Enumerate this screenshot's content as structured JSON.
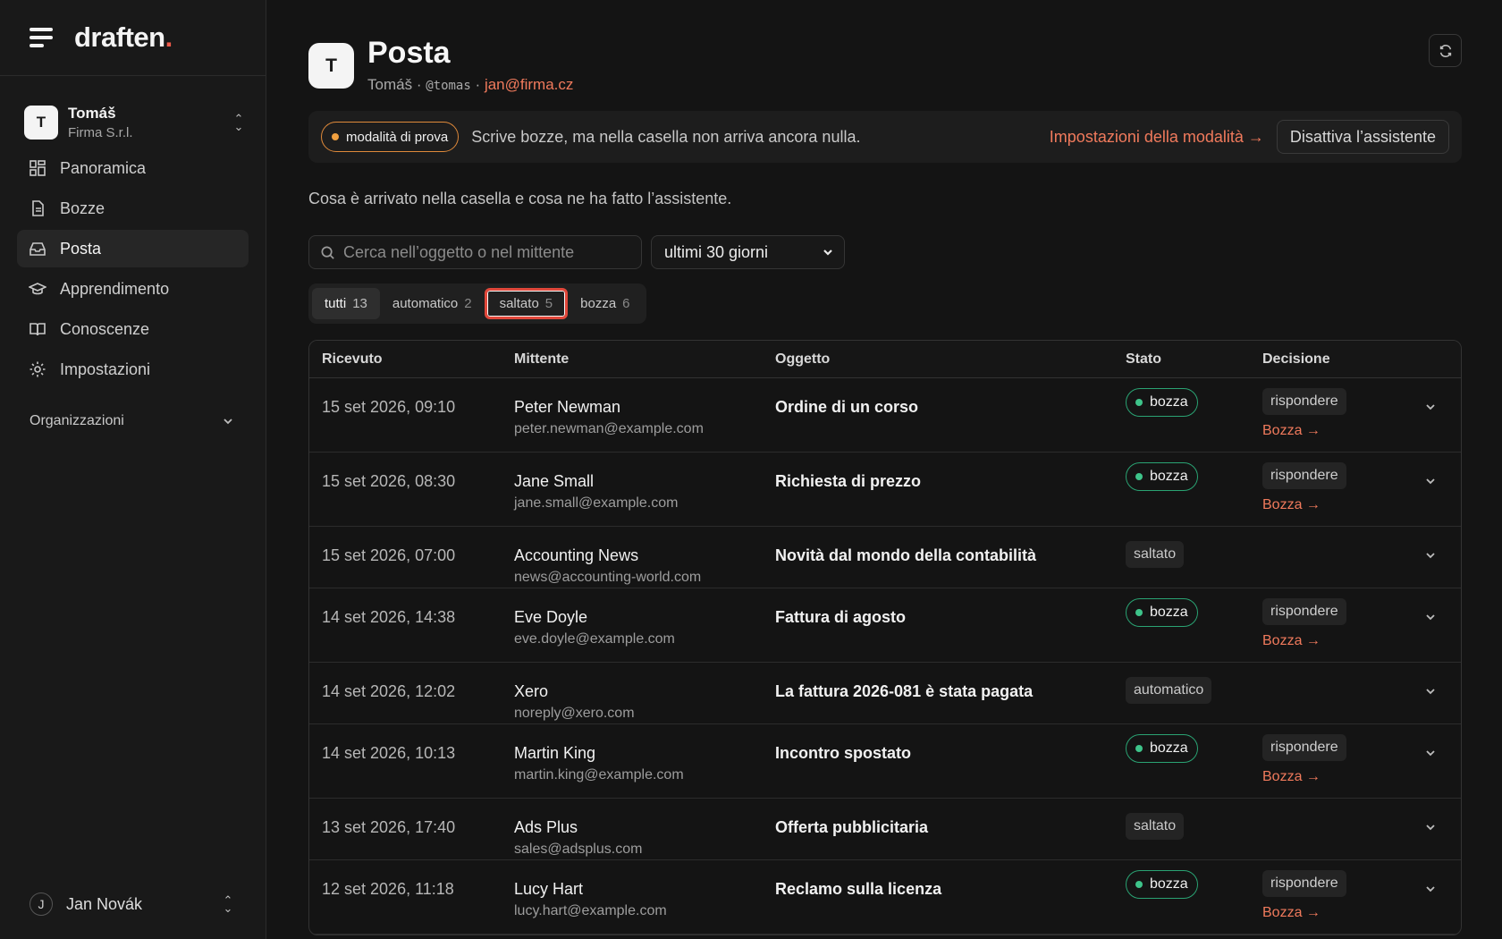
{
  "brand": {
    "name": "draften",
    "dot": "."
  },
  "account": {
    "initial": "T",
    "name": "Tomáš",
    "org": "Firma S.r.l."
  },
  "nav": [
    {
      "label": "Panoramica",
      "icon": "dashboard-icon"
    },
    {
      "label": "Bozze",
      "icon": "document-icon"
    },
    {
      "label": "Posta",
      "icon": "inbox-icon",
      "active": true
    },
    {
      "label": "Apprendimento",
      "icon": "graduation-cap-icon"
    },
    {
      "label": "Conoscenze",
      "icon": "book-icon"
    },
    {
      "label": "Impostazioni",
      "icon": "gear-icon"
    }
  ],
  "organizations_label": "Organizzazioni",
  "user": {
    "initial": "J",
    "name": "Jan Novák"
  },
  "header": {
    "initial": "T",
    "title": "Posta",
    "name": "Tomáš",
    "sep": "·",
    "handle": "@tomas",
    "email": "jan@firma.cz"
  },
  "trial": {
    "badge": "modalità di prova",
    "text": "Scrive bozze, ma nella casella non arriva ancora nulla.",
    "link": "Impostazioni della modalità →",
    "button": "Disattiva l’assistente"
  },
  "intro": "Cosa è arrivato nella casella e cosa ne ha fatto l’assistente.",
  "search": {
    "placeholder": "Cerca nell’oggetto o nel mittente"
  },
  "period": {
    "selected": "ultimi 30 giorni"
  },
  "tabs": [
    {
      "label": "tutti",
      "count": "13"
    },
    {
      "label": "automatico",
      "count": "2"
    },
    {
      "label": "saltato",
      "count": "5"
    },
    {
      "label": "bozza",
      "count": "6"
    }
  ],
  "table": {
    "headers": [
      "Ricevuto",
      "Mittente",
      "Oggetto",
      "Stato",
      "Decisione"
    ],
    "rows": [
      {
        "date": "15 set 2026, 09:10",
        "sender": "Peter Newman",
        "email": "peter.newman@example.com",
        "subject": "Ordine di un corso",
        "status": "bozza",
        "decision": "rispondere",
        "link": "Bozza →"
      },
      {
        "date": "15 set 2026, 08:30",
        "sender": "Jane Small",
        "email": "jane.small@example.com",
        "subject": "Richiesta di prezzo",
        "status": "bozza",
        "decision": "rispondere",
        "link": "Bozza →"
      },
      {
        "date": "15 set 2026, 07:00",
        "sender": "Accounting News",
        "email": "news@accounting-world.com",
        "subject": "Novità dal mondo della contabilità",
        "status": "saltato",
        "decision": "",
        "link": ""
      },
      {
        "date": "14 set 2026, 14:38",
        "sender": "Eve Doyle",
        "email": "eve.doyle@example.com",
        "subject": "Fattura di agosto",
        "status": "bozza",
        "decision": "rispondere",
        "link": "Bozza →"
      },
      {
        "date": "14 set 2026, 12:02",
        "sender": "Xero",
        "email": "noreply@xero.com",
        "subject": "La fattura 2026-081 è stata pagata",
        "status": "automatico",
        "decision": "",
        "link": ""
      },
      {
        "date": "14 set 2026, 10:13",
        "sender": "Martin King",
        "email": "martin.king@example.com",
        "subject": "Incontro spostato",
        "status": "bozza",
        "decision": "rispondere",
        "link": "Bozza →"
      },
      {
        "date": "13 set 2026, 17:40",
        "sender": "Ads Plus",
        "email": "sales@adsplus.com",
        "subject": "Offerta pubblicitaria",
        "status": "saltato",
        "decision": "",
        "link": ""
      },
      {
        "date": "12 set 2026, 11:18",
        "sender": "Lucy Hart",
        "email": "lucy.hart@example.com",
        "subject": "Reclamo sulla licenza",
        "status": "bozza",
        "decision": "rispondere",
        "link": "Bozza →"
      }
    ]
  },
  "colors": {
    "accent": "#f07a5c",
    "trial": "#f0a040",
    "draft": "#3ec48a",
    "focus": "#e0473a"
  }
}
